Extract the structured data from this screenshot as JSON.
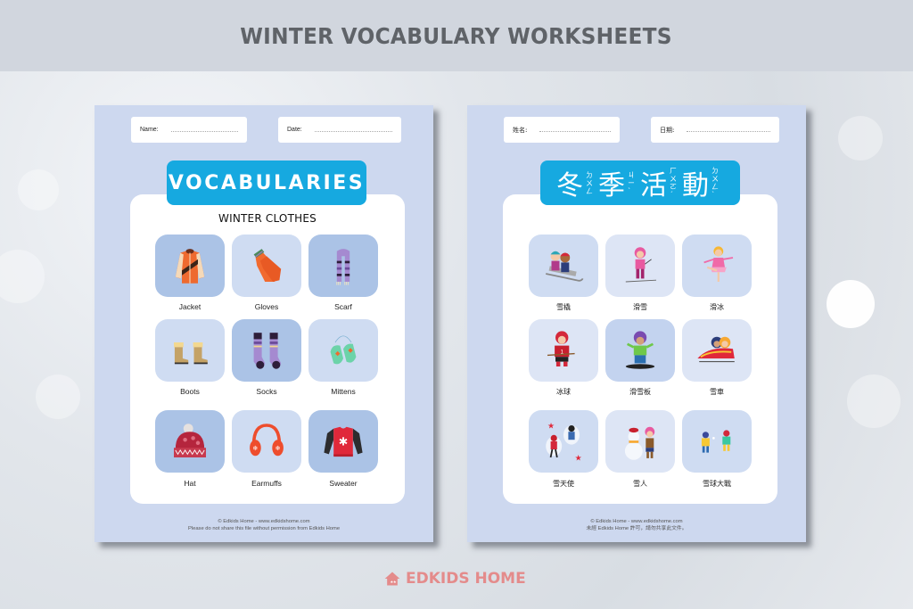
{
  "header": {
    "title": "WINTER VOCABULARY WORKSHEETS"
  },
  "left_sheet": {
    "name_label": "Name:",
    "date_label": "Date:",
    "title": "VOCABULARIES",
    "subtitle": "WINTER CLOTHES",
    "items": [
      {
        "label": "Jacket",
        "icon": "jacket-icon"
      },
      {
        "label": "Gloves",
        "icon": "gloves-icon"
      },
      {
        "label": "Scarf",
        "icon": "scarf-icon"
      },
      {
        "label": "Boots",
        "icon": "boots-icon"
      },
      {
        "label": "Socks",
        "icon": "socks-icon"
      },
      {
        "label": "Mittens",
        "icon": "mittens-icon"
      },
      {
        "label": "Hat",
        "icon": "hat-icon"
      },
      {
        "label": "Earmuffs",
        "icon": "earmuffs-icon"
      },
      {
        "label": "Sweater",
        "icon": "sweater-icon"
      }
    ],
    "footer_line1": "© Edkids Home - www.edkidshome.com",
    "footer_line2": "Please do not share this file without permission from Edkids Home"
  },
  "right_sheet": {
    "name_label": "姓名:",
    "date_label": "日期:",
    "title_chars": [
      {
        "char": "冬",
        "zhuyin": "ㄉㄨㄥ"
      },
      {
        "char": "季",
        "zhuyin": "ㄐㄧˋ"
      },
      {
        "char": "活",
        "zhuyin": "ㄏㄨㄛˊ"
      },
      {
        "char": "動",
        "zhuyin": "ㄉㄨㄥˋ"
      }
    ],
    "items": [
      {
        "label": "雪橇",
        "icon": "sledding-icon"
      },
      {
        "label": "滑雪",
        "icon": "skiing-icon"
      },
      {
        "label": "滑冰",
        "icon": "ice-skating-icon"
      },
      {
        "label": "冰球",
        "icon": "ice-hockey-icon"
      },
      {
        "label": "滑雪板",
        "icon": "snowboarding-icon"
      },
      {
        "label": "雪車",
        "icon": "bobsled-icon"
      },
      {
        "label": "雪天使",
        "icon": "snow-angel-icon"
      },
      {
        "label": "雪人",
        "icon": "snowman-icon"
      },
      {
        "label": "雪球大戰",
        "icon": "snowball-fight-icon"
      }
    ],
    "footer_line1": "© Edkids Home - www.edkidshome.com",
    "footer_line2": "未經 Edkids Home 許可，請勿共享此文件。"
  },
  "brand": {
    "name": "EDKIDS HOME",
    "color": "#e48b8b"
  },
  "colors": {
    "title_bar": "#16a9e0",
    "sheet": "#cdd8ef",
    "header_bg": "#d1d6de"
  }
}
